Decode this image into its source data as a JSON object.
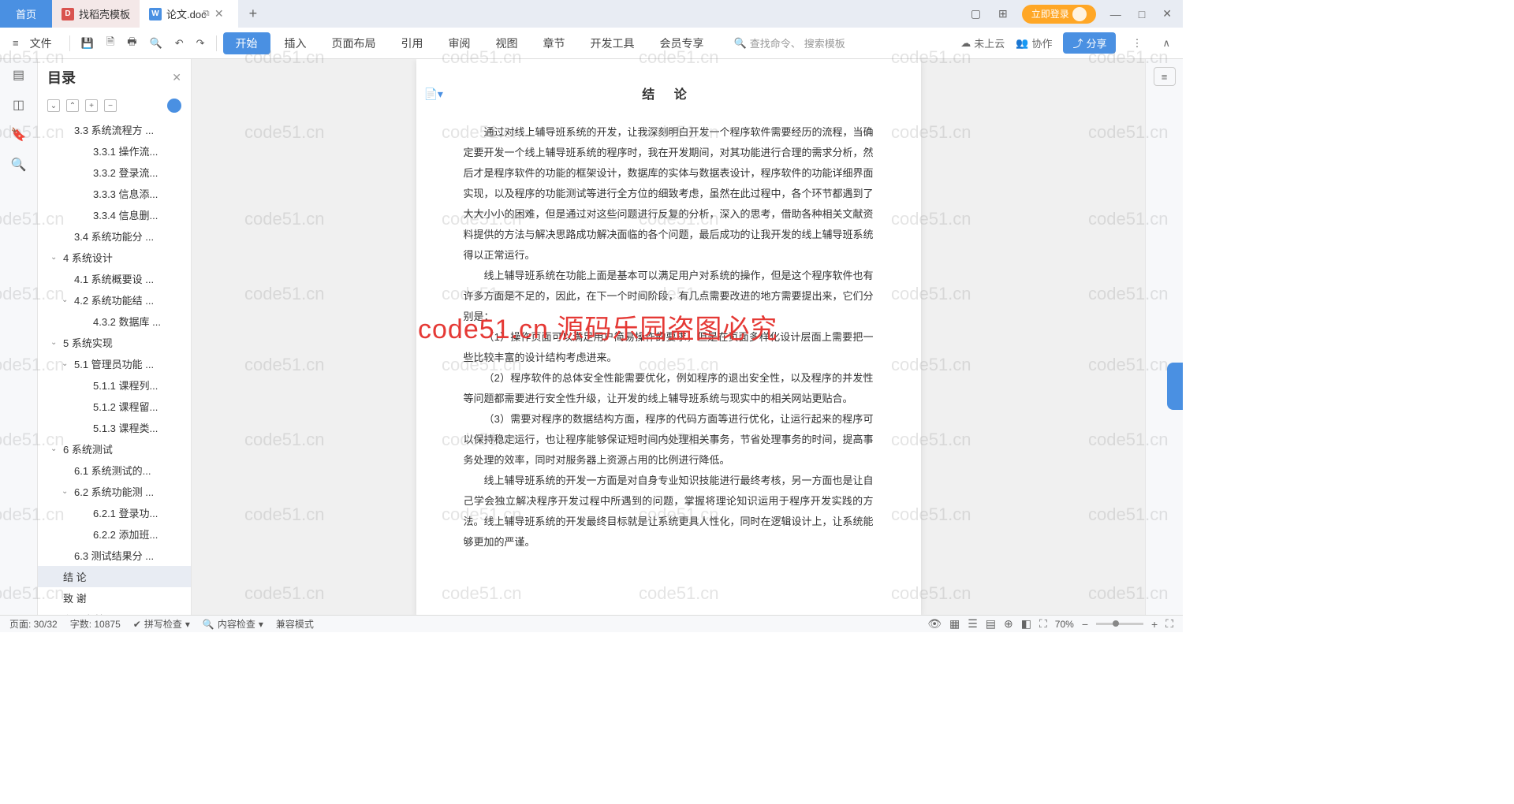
{
  "titlebar": {
    "home": "首页",
    "template_tab": "找稻壳模板",
    "doc_tab": "论文.doc",
    "login": "立即登录"
  },
  "ribbon": {
    "file": "文件",
    "menu": [
      "开始",
      "插入",
      "页面布局",
      "引用",
      "审阅",
      "视图",
      "章节",
      "开发工具",
      "会员专享"
    ],
    "search_cmd": "查找命令、",
    "search_tpl": "搜索模板",
    "cloud": "未上云",
    "collab": "协作",
    "share": "分享"
  },
  "sidebar": {
    "title": "目录",
    "items": [
      {
        "lv": "l2",
        "chev": "",
        "txt": "3.3 系统流程方 ..."
      },
      {
        "lv": "l3",
        "chev": "",
        "txt": "3.3.1 操作流..."
      },
      {
        "lv": "l3",
        "chev": "",
        "txt": "3.3.2 登录流..."
      },
      {
        "lv": "l3",
        "chev": "",
        "txt": "3.3.3 信息添..."
      },
      {
        "lv": "l3",
        "chev": "",
        "txt": "3.3.4 信息删..."
      },
      {
        "lv": "l2",
        "chev": "",
        "txt": "3.4 系统功能分 ..."
      },
      {
        "lv": "l1",
        "chev": "⌄",
        "txt": "4 系统设计"
      },
      {
        "lv": "l2",
        "chev": "",
        "txt": "4.1 系统概要设 ..."
      },
      {
        "lv": "l2",
        "chev": "⌄",
        "txt": "4.2 系统功能结 ..."
      },
      {
        "lv": "l3",
        "chev": "",
        "txt": "4.3.2 数据库 ..."
      },
      {
        "lv": "l1",
        "chev": "⌄",
        "txt": "5 系统实现"
      },
      {
        "lv": "l2",
        "chev": "⌄",
        "txt": "5.1 管理员功能 ..."
      },
      {
        "lv": "l3",
        "chev": "",
        "txt": "5.1.1 课程列..."
      },
      {
        "lv": "l3",
        "chev": "",
        "txt": "5.1.2 课程留..."
      },
      {
        "lv": "l3",
        "chev": "",
        "txt": "5.1.3 课程类..."
      },
      {
        "lv": "l1",
        "chev": "⌄",
        "txt": "6 系统测试"
      },
      {
        "lv": "l2",
        "chev": "",
        "txt": "6.1 系统测试的..."
      },
      {
        "lv": "l2",
        "chev": "⌄",
        "txt": "6.2 系统功能测 ..."
      },
      {
        "lv": "l3",
        "chev": "",
        "txt": "6.2.1 登录功..."
      },
      {
        "lv": "l3",
        "chev": "",
        "txt": "6.2.2 添加班..."
      },
      {
        "lv": "l2",
        "chev": "",
        "txt": "6.3 测试结果分 ..."
      },
      {
        "lv": "l1",
        "chev": "",
        "txt": "结  论",
        "sel": true
      },
      {
        "lv": "l1",
        "chev": "",
        "txt": "致  谢"
      },
      {
        "lv": "l1",
        "chev": "",
        "txt": "参考文献"
      }
    ]
  },
  "doc": {
    "heading": "结  论",
    "p1": "通过对线上辅导班系统的开发，让我深刻明白开发一个程序软件需要经历的流程，当确定要开发一个线上辅导班系统的程序时，我在开发期间，对其功能进行合理的需求分析，然后才是程序软件的功能的框架设计，数据库的实体与数据表设计，程序软件的功能详细界面实现，以及程序的功能测试等进行全方位的细致考虑，虽然在此过程中，各个环节都遇到了大大小小的困难，但是通过对这些问题进行反复的分析，深入的思考，借助各种相关文献资料提供的方法与解决思路成功解决面临的各个问题，最后成功的让我开发的线上辅导班系统得以正常运行。",
    "p2": "线上辅导班系统在功能上面是基本可以满足用户对系统的操作，但是这个程序软件也有许多方面是不足的，因此，在下一个时间阶段，有几点需要改进的地方需要提出来，它们分别是：",
    "p3": "（1）操作页面可以满足用户简易操作的要求，但是在页面多样化设计层面上需要把一些比较丰富的设计结构考虑进来。",
    "p4": "（2）程序软件的总体安全性能需要优化，例如程序的退出安全性，以及程序的并发性等问题都需要进行安全性升级，让开发的线上辅导班系统与现实中的相关网站更贴合。",
    "p5": "（3）需要对程序的数据结构方面，程序的代码方面等进行优化，让运行起来的程序可以保持稳定运行，也让程序能够保证短时间内处理相关事务，节省处理事务的时间，提高事务处理的效率，同时对服务器上资源占用的比例进行降低。",
    "p6": "线上辅导班系统的开发一方面是对自身专业知识技能进行最终考核，另一方面也是让自己学会独立解决程序开发过程中所遇到的问题，掌握将理论知识运用于程序开发实践的方法。线上辅导班系统的开发最终目标就是让系统更具人性化，同时在逻辑设计上，让系统能够更加的严谨。"
  },
  "status": {
    "page": "页面: 30/32",
    "words": "字数: 10875",
    "spell": "拼写检查",
    "content": "内容检查",
    "compat": "兼容模式",
    "zoom": "70%"
  },
  "watermark": {
    "grey": "code51.cn",
    "red": "code51.cn  源码乐园盗图必究"
  }
}
